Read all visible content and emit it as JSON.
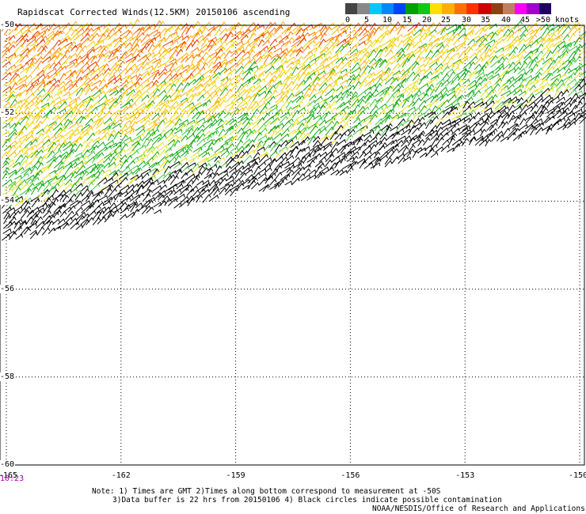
{
  "title": "Rapidscat Corrected Winds(12.5KM) 20150106 ascending",
  "scale": {
    "colors": [
      "#444444",
      "#888888",
      "#00c8ff",
      "#0088ff",
      "#0040ff",
      "#00a000",
      "#10c810",
      "#ffe000",
      "#ffb000",
      "#ff7000",
      "#ff3000",
      "#d00000",
      "#8b4010",
      "#c08060",
      "#ff00ff",
      "#a000d0",
      "#200060"
    ],
    "labels": [
      "0",
      "5",
      "10",
      "15",
      "20",
      "25",
      "30",
      "35",
      "40",
      "45",
      ">50 knots"
    ]
  },
  "latitudes": [
    "-50",
    "-52",
    "-54",
    "-56",
    "-58",
    "-60"
  ],
  "longitudes": [
    "-165",
    "-162",
    "-159",
    "-156",
    "-153",
    "-150"
  ],
  "time_label": "10:23",
  "notes": {
    "line1": "Note: 1) Times are GMT 2)Times along bottom correspond to measurement at -50S",
    "line2": "3)Data buffer is 22 hrs from 20150106 4) Black circles indicate possible contamination",
    "line3": "NOAA/NESDIS/Office of Research and Applications"
  }
}
